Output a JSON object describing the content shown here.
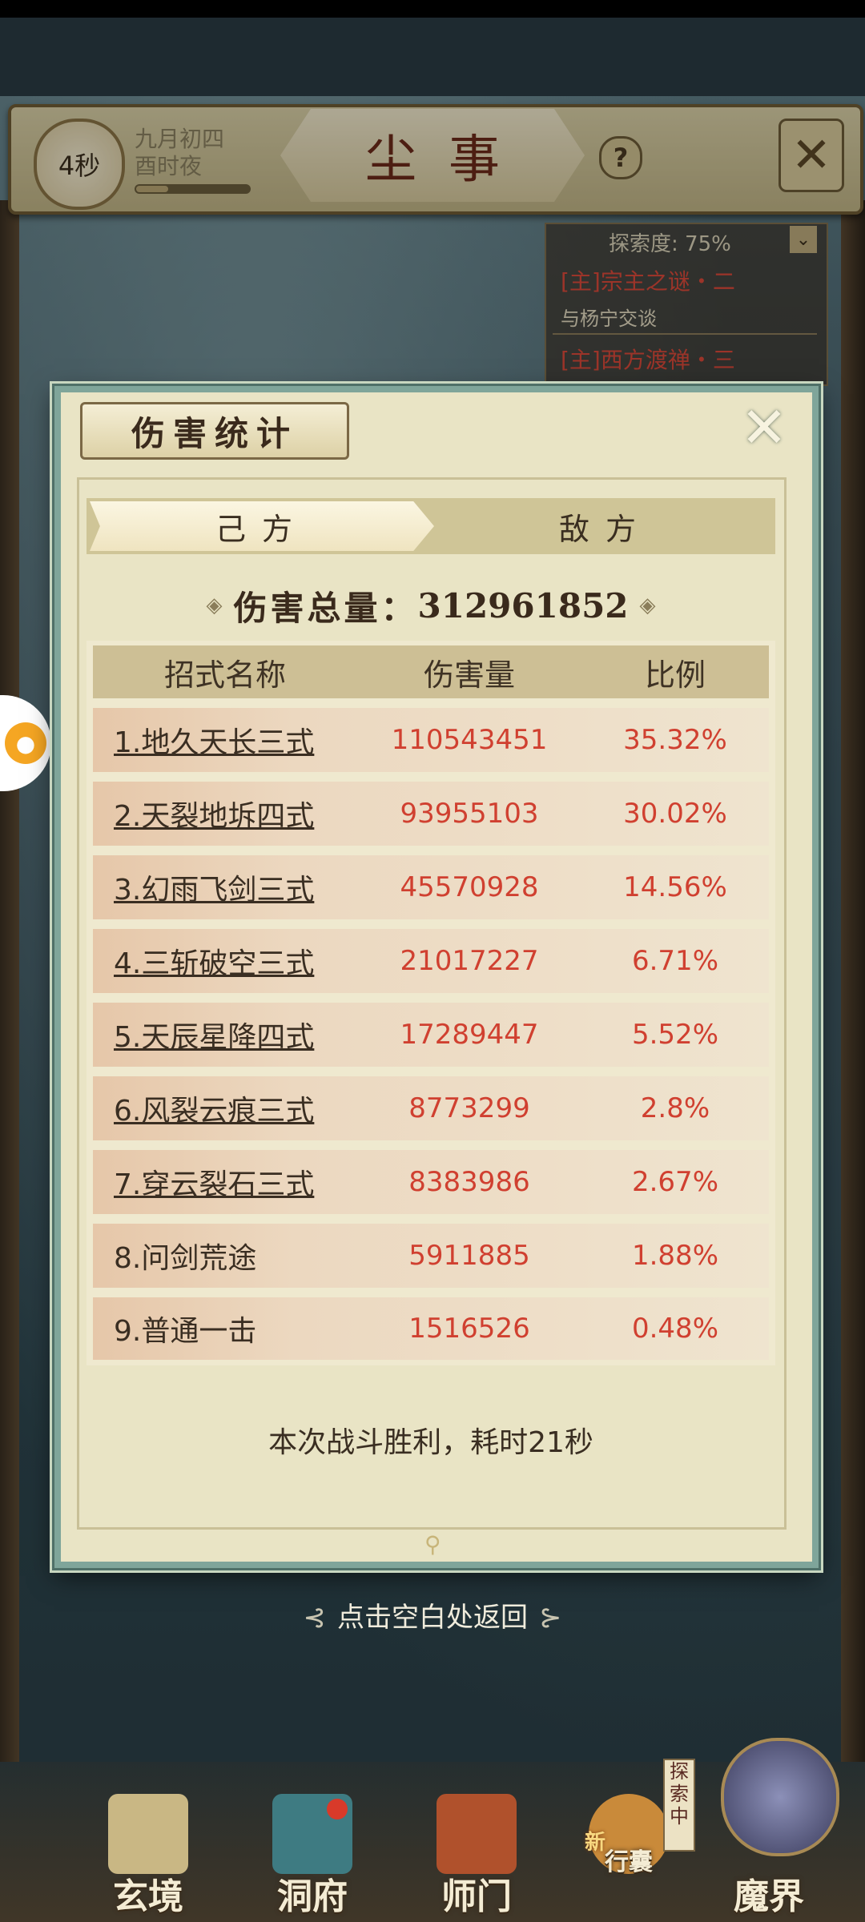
{
  "header": {
    "timer": "4秒",
    "date_line1": "九月初四",
    "date_line2": "酉时夜",
    "title": "尘事",
    "help_symbol": "?",
    "close_symbol": "✕"
  },
  "quest_panel": {
    "progress": "探索度: 75%",
    "collapse_symbol": "⌄",
    "quests": [
      {
        "title": "[主]宗主之谜・二",
        "subtitle": "与杨宁交谈"
      },
      {
        "title": "[主]西方渡禅・三"
      }
    ]
  },
  "dialog": {
    "title": "伤害统计",
    "close_symbol": "✕",
    "tabs": [
      {
        "label": "己方",
        "active": true
      },
      {
        "label": "敌方",
        "active": false
      }
    ],
    "total_label": "伤害总量：",
    "total_value": "312961852",
    "diamond": "◈",
    "columns": [
      "招式名称",
      "伤害量",
      "比例"
    ],
    "rows": [
      {
        "name": "1.地久天长三式",
        "damage": "110543451",
        "ratio": "35.32%"
      },
      {
        "name": "2.天裂地坼四式",
        "damage": "93955103",
        "ratio": "30.02%"
      },
      {
        "name": "3.幻雨飞剑三式",
        "damage": "45570928",
        "ratio": "14.56%"
      },
      {
        "name": "4.三斩破空三式",
        "damage": "21017227",
        "ratio": "6.71%"
      },
      {
        "name": "5.天辰星降四式",
        "damage": "17289447",
        "ratio": "5.52%"
      },
      {
        "name": "6.风裂云痕三式",
        "damage": "8773299",
        "ratio": "2.8%"
      },
      {
        "name": "7.穿云裂石三式",
        "damage": "8383986",
        "ratio": "2.67%"
      },
      {
        "name": "8.问剑荒途",
        "damage": "5911885",
        "ratio": "1.88%"
      },
      {
        "name": "9.普通一击",
        "damage": "1516526",
        "ratio": "0.48%"
      }
    ],
    "result_text": "本次战斗胜利，耗时21秒"
  },
  "return_hint": "点击空白处返回",
  "bottom_nav": [
    {
      "label": "玄境"
    },
    {
      "label": "洞府"
    },
    {
      "label": "师门"
    },
    {
      "label": "行囊",
      "badge_text": "新"
    },
    {
      "label": "魔界"
    }
  ],
  "explore_tag": "探索中",
  "colors": {
    "damage_text": "#d04030",
    "dialog_bg": "#e9e4c5",
    "dialog_border": "#7fa59a"
  }
}
